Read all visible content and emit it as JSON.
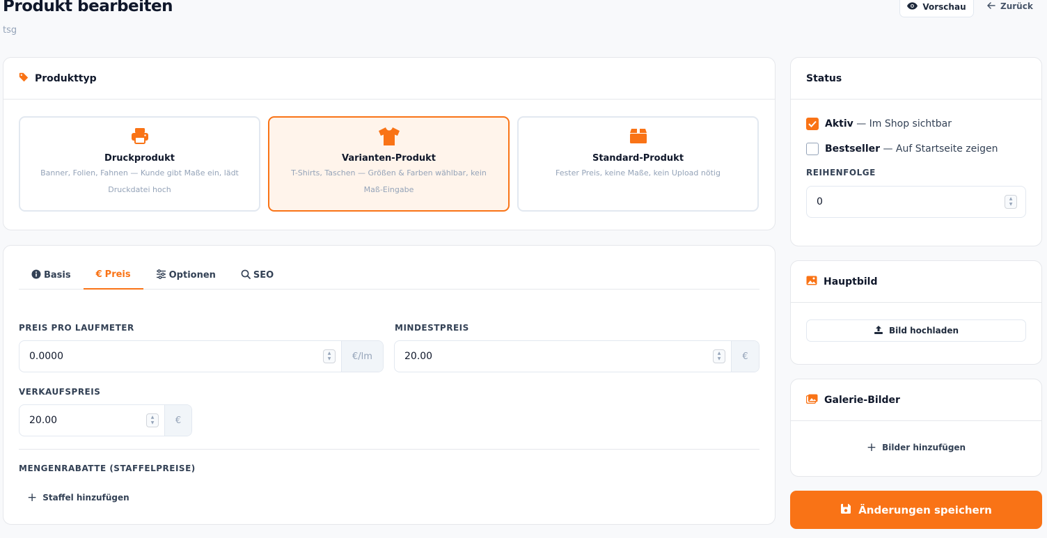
{
  "header": {
    "title": "Produkt bearbeiten",
    "subtitle": "tsg",
    "preview_label": "Vorschau",
    "back_label": "Zurück"
  },
  "product_type": {
    "heading": "Produkttyp",
    "options": [
      {
        "title": "Druckprodukt",
        "desc": "Banner, Folien, Fahnen — Kunde gibt Maße ein, lädt Druckdatei hoch",
        "selected": false,
        "icon": "printer-icon"
      },
      {
        "title": "Varianten-Produkt",
        "desc": "T-Shirts, Taschen — Größen & Farben wählbar, kein Maß-Eingabe",
        "selected": true,
        "icon": "tshirt-icon"
      },
      {
        "title": "Standard-Produkt",
        "desc": "Fester Preis, keine Maße, kein Upload nötig",
        "selected": false,
        "icon": "box-icon"
      }
    ]
  },
  "tabs": [
    {
      "label": "Basis",
      "icon": "info-icon",
      "active": false
    },
    {
      "label": "Preis",
      "icon": "euro-icon",
      "active": true
    },
    {
      "label": "Optionen",
      "icon": "sliders-icon",
      "active": false
    },
    {
      "label": "SEO",
      "icon": "search-icon",
      "active": false
    }
  ],
  "pricing": {
    "price_per_meter": {
      "label": "PREIS PRO LAUFMETER",
      "value": "0.0000",
      "suffix": "€/lm"
    },
    "min_price": {
      "label": "MINDESTPREIS",
      "value": "20.00",
      "suffix": "€"
    },
    "sale_price": {
      "label": "VERKAUFSPREIS",
      "value": "20.00",
      "suffix": "€"
    },
    "tier_heading": "MENGENRABATTE (STAFFELPREISE)",
    "add_tier_label": "Staffel hinzufügen"
  },
  "status": {
    "heading": "Status",
    "active": {
      "name": "Aktiv",
      "desc": " — Im Shop sichtbar",
      "checked": true
    },
    "bestseller": {
      "name": "Bestseller",
      "desc": " — Auf Startseite zeigen",
      "checked": false
    },
    "order_label": "REIHENFOLGE",
    "order_value": "0"
  },
  "main_image": {
    "heading": "Hauptbild",
    "upload_label": "Bild hochladen"
  },
  "gallery": {
    "heading": "Galerie-Bilder",
    "add_label": "Bilder hinzufügen"
  },
  "save_label": "Änderungen speichern",
  "colors": {
    "accent": "#f97316",
    "accent_bg": "#fff4eb"
  }
}
